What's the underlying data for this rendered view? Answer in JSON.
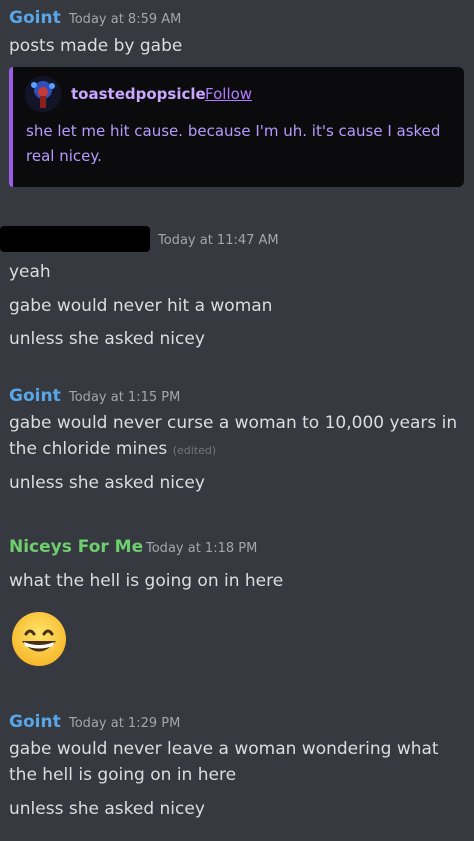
{
  "messages": [
    {
      "author": "Goint",
      "author_color": "#58a6e8",
      "timestamp": "Today at 8:59 AM",
      "lines": [
        "posts made by gabe"
      ],
      "embed": {
        "username": "toastedpopsicle",
        "follow_label": "Follow",
        "text_lines": [
          "she let me hit cause. because I'm uh. it's cause I asked",
          "real nicey."
        ]
      }
    },
    {
      "author": "",
      "timestamp": "Today at 11:47 AM",
      "lines": [
        "yeah",
        "gabe would never hit a woman",
        "unless she asked nicey"
      ]
    },
    {
      "author": "Goint",
      "author_color": "#58a6e8",
      "timestamp": "Today at 1:15 PM",
      "lines": [
        "gabe would never curse a woman to 10,000 years in",
        "the chloride mines",
        "unless she asked nicey"
      ],
      "edited_label": "(edited)"
    },
    {
      "author": "Niceys For Me",
      "author_color": "#6fcf6f",
      "timestamp": "Today at 1:18 PM",
      "lines": [
        "what the hell is going on in here"
      ],
      "emoji": "grinning-face-emoji"
    },
    {
      "author": "Goint",
      "author_color": "#58a6e8",
      "timestamp": "Today at 1:29 PM",
      "lines": [
        "gabe would never leave a woman wondering what",
        "the hell is going on in here",
        "unless she asked nicey"
      ]
    }
  ]
}
